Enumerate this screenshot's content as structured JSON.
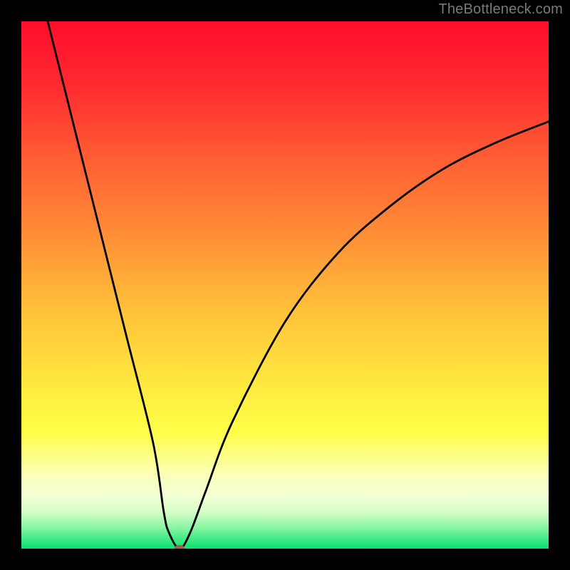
{
  "watermark": "TheBottleneck.com",
  "colors": {
    "frame": "#000000",
    "dot": "#b15a4a",
    "curve": "#000000",
    "gradient_stops": [
      {
        "pct": 0,
        "color": "#ff0e2b"
      },
      {
        "pct": 12,
        "color": "#ff2a30"
      },
      {
        "pct": 25,
        "color": "#ff5a33"
      },
      {
        "pct": 40,
        "color": "#ff8c36"
      },
      {
        "pct": 55,
        "color": "#ffc23a"
      },
      {
        "pct": 68,
        "color": "#ffe63e"
      },
      {
        "pct": 78,
        "color": "#ffff48"
      },
      {
        "pct": 86,
        "color": "#fbffb8"
      },
      {
        "pct": 90,
        "color": "#f3ffd6"
      },
      {
        "pct": 93,
        "color": "#d6ffc8"
      },
      {
        "pct": 96,
        "color": "#88f5a2"
      },
      {
        "pct": 100,
        "color": "#07e26f"
      }
    ]
  },
  "chart_data": {
    "type": "line",
    "title": "",
    "xlabel": "",
    "ylabel": "",
    "xlim": [
      0,
      100
    ],
    "ylim": [
      0,
      100
    ],
    "grid": false,
    "legend_position": "none",
    "annotations": [
      "TheBottleneck.com"
    ],
    "minimum_point": {
      "x": 30,
      "y": 0
    },
    "curve_key_points": [
      {
        "x": 5,
        "y": 100
      },
      {
        "x": 10,
        "y": 80
      },
      {
        "x": 15,
        "y": 60
      },
      {
        "x": 20,
        "y": 40
      },
      {
        "x": 25,
        "y": 20
      },
      {
        "x": 27,
        "y": 7
      },
      {
        "x": 28,
        "y": 3
      },
      {
        "x": 30,
        "y": 0
      },
      {
        "x": 32,
        "y": 3
      },
      {
        "x": 35,
        "y": 11
      },
      {
        "x": 40,
        "y": 24
      },
      {
        "x": 50,
        "y": 43
      },
      {
        "x": 60,
        "y": 56
      },
      {
        "x": 70,
        "y": 65
      },
      {
        "x": 80,
        "y": 72
      },
      {
        "x": 90,
        "y": 77
      },
      {
        "x": 100,
        "y": 81
      }
    ]
  }
}
